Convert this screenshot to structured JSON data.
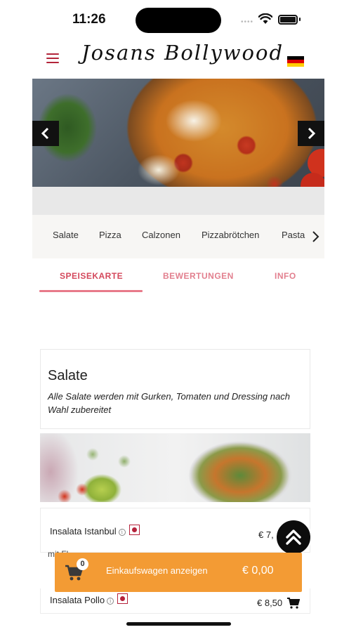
{
  "status_bar": {
    "time": "11:26"
  },
  "header": {
    "brand": "Josans Bollywood",
    "menu_icon": "hamburger-menu-icon",
    "language_flag": "german-flag-icon",
    "flag_colors": [
      "#000000",
      "#dd0000",
      "#ffce00"
    ],
    "accent_color": "#b3253a"
  },
  "hero": {
    "prev_icon": "chevron-left-icon",
    "next_icon": "chevron-right-icon"
  },
  "categories": {
    "items": [
      "Salate",
      "Pizza",
      "Calzonen",
      "Pizzabrötchen",
      "Pasta"
    ],
    "next_icon": "chevron-right-icon"
  },
  "tabs": {
    "items": [
      "SPEISEKARTE",
      "BEWERTUNGEN",
      "INFO"
    ],
    "active": "SPEISEKARTE"
  },
  "section": {
    "title": "Salate",
    "description": "Alle Salate werden mit Gurken, Tomaten und Dressing nach Wahl zubereitet"
  },
  "products": [
    {
      "name": "Insalata Istanbul",
      "price": "€ 7,",
      "description": "mit Fl...",
      "info_icon": "info-icon",
      "badge_icon": "allergen-badge-icon"
    },
    {
      "name": "Insalata Pollo",
      "price": "€ 8,50",
      "info_icon": "info-icon",
      "badge_icon": "allergen-badge-icon",
      "cart_icon": "cart-icon"
    }
  ],
  "scroll_top": {
    "icon": "double-chevron-up-icon"
  },
  "cart": {
    "count": "0",
    "label": "Einkaufswagen anzeigen",
    "total": "€ 0,00",
    "icon": "shopping-cart-icon",
    "color": "#f39b34"
  }
}
